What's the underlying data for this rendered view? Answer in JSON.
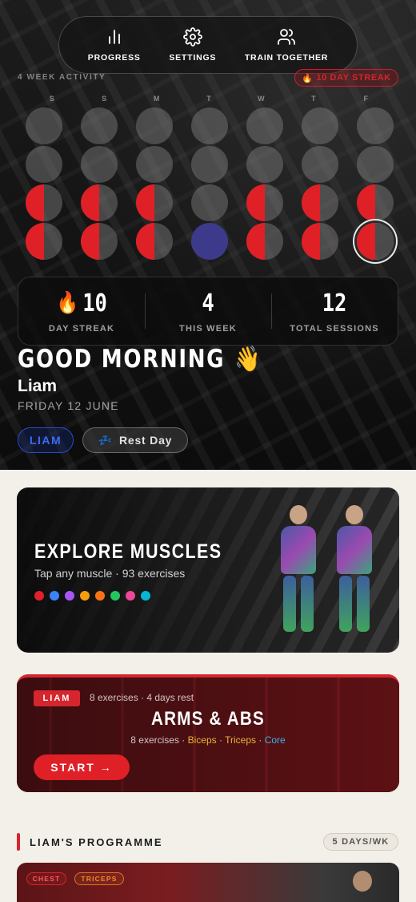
{
  "nav": {
    "items": [
      {
        "label": "PROGRESS",
        "icon": "bar-chart-icon"
      },
      {
        "label": "SETTINGS",
        "icon": "gear-icon"
      },
      {
        "label": "TRAIN TOGETHER",
        "icon": "users-icon"
      }
    ]
  },
  "activity": {
    "label": "4 WEEK ACTIVITY",
    "streak_pill": "10 DAY STREAK",
    "day_headers": [
      "S",
      "S",
      "M",
      "T",
      "W",
      "T",
      "F"
    ],
    "weeks": [
      [
        "empty",
        "empty",
        "empty",
        "empty",
        "empty",
        "empty",
        "empty"
      ],
      [
        "empty",
        "empty",
        "empty",
        "empty",
        "empty",
        "empty",
        "empty"
      ],
      [
        "half",
        "half",
        "half",
        "empty",
        "half",
        "half",
        "half"
      ],
      [
        "half",
        "half",
        "half",
        "today",
        "half",
        "half",
        "half-ring"
      ]
    ]
  },
  "stats": [
    {
      "value": "10",
      "label": "DAY STREAK",
      "icon": "flame-icon"
    },
    {
      "value": "4",
      "label": "THIS WEEK"
    },
    {
      "value": "12",
      "label": "TOTAL SESSIONS"
    }
  ],
  "greeting": {
    "text": "GOOD MORNING",
    "emoji": "👋",
    "name": "Liam",
    "date": "FRIDAY 12 JUNE",
    "user_chip": "LIAM",
    "rest_chip": "Rest Day",
    "rest_icon": "sleep-icon"
  },
  "explore": {
    "title": "EXPLORE MUSCLES",
    "subtitle": "Tap any muscle · 93 exercises",
    "colors": [
      "#e02129",
      "#3b82f6",
      "#a855f7",
      "#f59e0b",
      "#f97316",
      "#22c55e",
      "#ec4899",
      "#06b6d4"
    ]
  },
  "workout": {
    "tag": "LIAM",
    "meta": "8 exercises · 4 days rest",
    "title": "ARMS & ABS",
    "count": "8 exercises",
    "muscles": [
      "Biceps",
      "Triceps",
      "Core"
    ],
    "start_label": "START →"
  },
  "programme": {
    "title": "LIAM'S PROGRAMME",
    "days_pill": "5 DAYS/WK",
    "card_tags": [
      "CHEST",
      "TRICEPS"
    ]
  }
}
